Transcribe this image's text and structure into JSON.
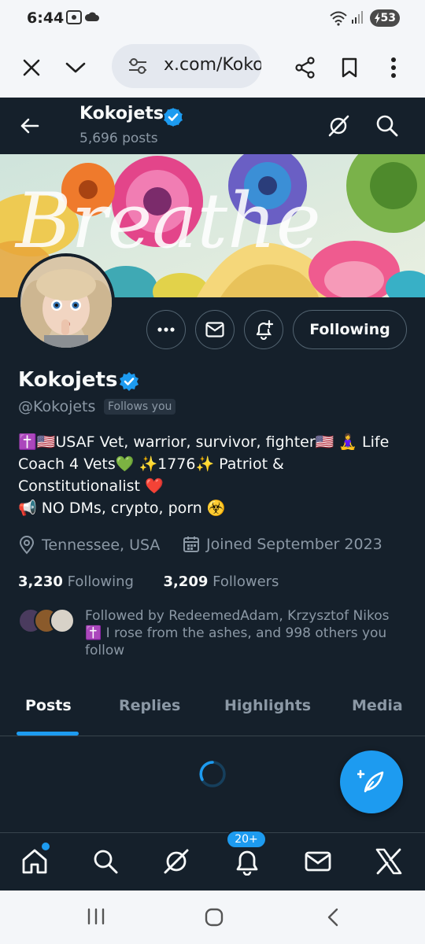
{
  "status_bar": {
    "time": "6:44",
    "battery": "53",
    "icons": [
      "screenshot-icon",
      "cloud-icon",
      "wifi-icon",
      "signal-icon",
      "battery-icon"
    ]
  },
  "browser": {
    "url": "x.com/Kokojets",
    "icons": [
      "close-icon",
      "chevron-down-icon",
      "site-settings-icon",
      "share-icon",
      "bookmark-icon",
      "more-vertical-icon"
    ]
  },
  "header": {
    "name": "Kokojets",
    "posts_count": "5,696 posts"
  },
  "profile": {
    "display_name": "Kokojets",
    "handle": "@Kokojets",
    "follows_you": "Follows you",
    "following_button": "Following",
    "bio_lines": [
      "✝️🇺🇸USAF Vet, warrior, survivor, fighter🇺🇸 🧘‍♀️ Life",
      "Coach 4 Vets💚 ✨1776✨ Patriot &",
      "Constitutionalist ❤️",
      "📢 NO DMs, crypto, porn ☣️"
    ],
    "location": "Tennessee, USA",
    "joined": "Joined September 2023",
    "following_count": "3,230",
    "following_label": "Following",
    "followers_count": "3,209",
    "followers_label": "Followers",
    "followed_by": "Followed by RedeemedAdam, Krzysztof Nikos ✝️ I rose from the ashes, and 998 others you follow",
    "banner_text": "Breathe"
  },
  "tabs": [
    {
      "label": "Posts",
      "active": true
    },
    {
      "label": "Replies",
      "active": false
    },
    {
      "label": "Highlights",
      "active": false
    },
    {
      "label": "Media",
      "active": false
    }
  ],
  "bottom_nav": {
    "notifications_badge": "20+",
    "items": [
      "home-icon",
      "search-icon",
      "grok-icon",
      "notifications-icon",
      "messages-icon",
      "x-logo-icon"
    ]
  },
  "colors": {
    "background": "#15202b",
    "accent": "#1d9bf0",
    "text_primary": "#f7f9f9",
    "text_secondary": "#8b98a5",
    "border": "#38444d"
  }
}
